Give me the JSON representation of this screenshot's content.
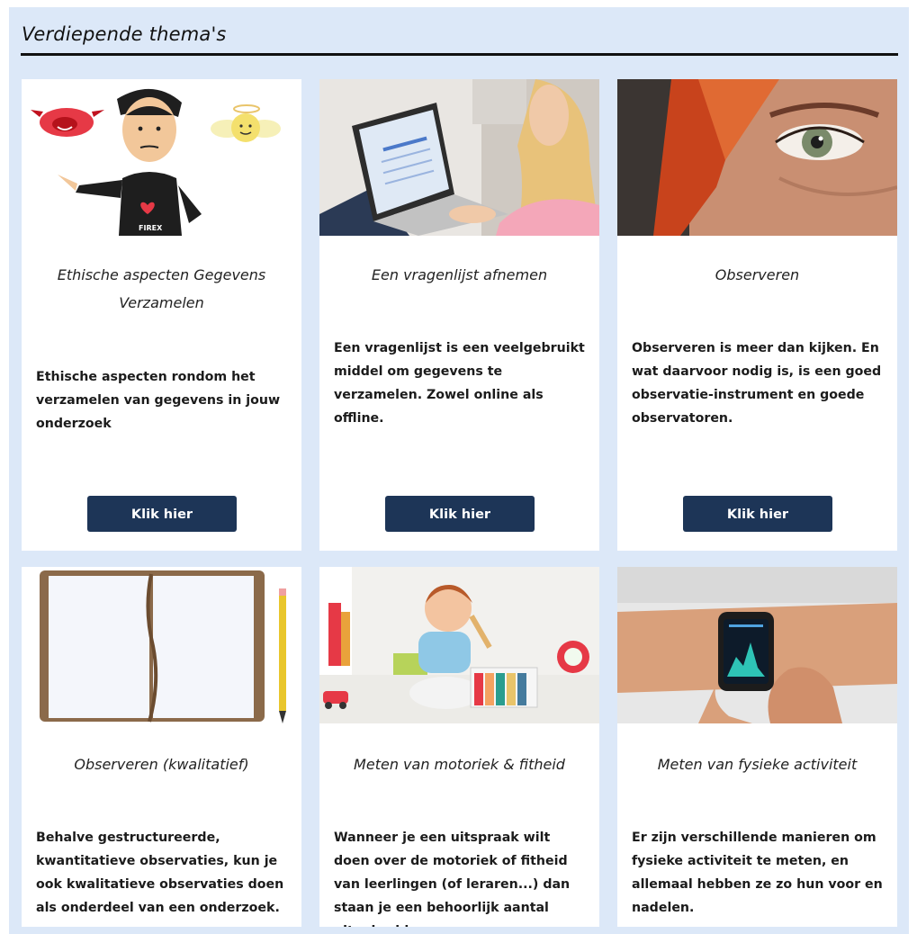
{
  "section": {
    "title": "Verdiepende thema's"
  },
  "cards": [
    {
      "title": "Ethische aspecten Gegevens Verzamelen",
      "description": "Ethische aspecten rondom het verzamelen van gegevens in jouw onderzoek",
      "button_label": "Klik hier",
      "image": "ethics-devil-angel-illustration",
      "image_text": "FIREX"
    },
    {
      "title": "Een vragenlijst afnemen",
      "description": "Een vragenlijst is een veelgebruikt middel om gegevens te verzamelen. Zowel online als offline.",
      "button_label": "Klik hier",
      "image": "woman-laptop-photo"
    },
    {
      "title": "Observeren",
      "description": "Observeren is meer dan kijken. En wat daarvoor nodig is, is een goed observatie-instrument en goede observatoren.",
      "button_label": "Klik hier",
      "image": "eye-closeup-photo"
    },
    {
      "title": "Observeren (kwalitatief)",
      "description": "Behalve gestructureerde, kwantitatieve observaties, kun je ook kwalitatieve observaties doen als onderdeel van een onderzoek.",
      "image": "notebook-pencil-illustration"
    },
    {
      "title": "Meten van motoriek & fitheid",
      "description": "Wanneer je een uitspraak wilt doen over de motoriek of fitheid van leerlingen (of leraren...) dan staan je een behoorlijk aantal uitgebreid",
      "image": "baby-playing-photo"
    },
    {
      "title": "Meten van fysieke activiteit",
      "description": "Er zijn verschillende manieren om fysieke activiteit te meten, en allemaal hebben ze zo hun voor en nadelen.",
      "image": "smartwatch-wrist-photo"
    }
  ]
}
